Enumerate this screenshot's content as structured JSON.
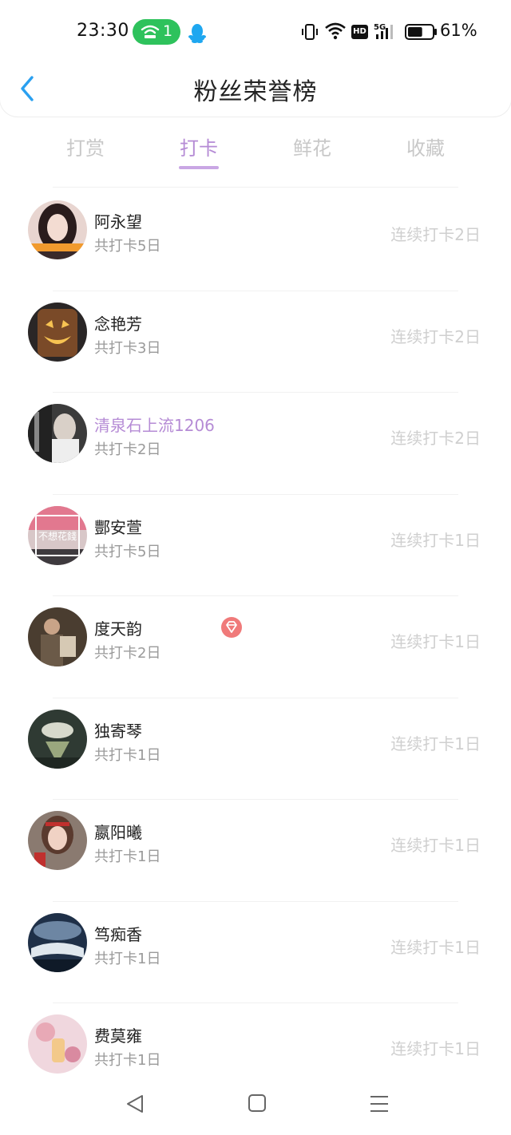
{
  "status_bar": {
    "time": "23:30",
    "hotspot_count": "1",
    "network": "5G",
    "hd_label": "HD",
    "battery_percent": "61%",
    "battery_level": 0.61
  },
  "header": {
    "title": "粉丝荣誉榜"
  },
  "tabs": [
    {
      "label": "打赏"
    },
    {
      "label": "打卡"
    },
    {
      "label": "鲜花"
    },
    {
      "label": "收藏"
    }
  ],
  "active_tab": "打卡",
  "fans": [
    {
      "name": "阿永望",
      "total": "共打卡5日",
      "streak": "连续打卡2日",
      "vip": false
    },
    {
      "name": "念艳芳",
      "total": "共打卡3日",
      "streak": "连续打卡2日",
      "vip": false
    },
    {
      "name": "清泉石上流1206",
      "total": "共打卡2日",
      "streak": "连续打卡2日",
      "vip": true
    },
    {
      "name": "酆安萱",
      "total": "共打卡5日",
      "streak": "连续打卡1日",
      "vip": false,
      "avatar_text": "不想花錢"
    },
    {
      "name": "度天韵",
      "total": "共打卡2日",
      "streak": "连续打卡1日",
      "vip": false
    },
    {
      "name": "独寄琴",
      "total": "共打卡1日",
      "streak": "连续打卡1日",
      "vip": false
    },
    {
      "name": "嬴阳曦",
      "total": "共打卡1日",
      "streak": "连续打卡1日",
      "vip": false
    },
    {
      "name": "笃痴香",
      "total": "共打卡1日",
      "streak": "连续打卡1日",
      "vip": false
    },
    {
      "name": "费莫雍",
      "total": "共打卡1日",
      "streak": "连续打卡1日",
      "vip": false
    }
  ],
  "colors": {
    "accent": "#b58bd5",
    "back_arrow": "#2aa0f0",
    "hotspot_green": "#2ec25c",
    "gem_red": "#f07a7a",
    "muted_text": "#cfcfcf"
  },
  "icons": [
    "hotspot-icon",
    "qq-icon",
    "vibrate-icon",
    "wifi-icon",
    "signal-icon",
    "battery-icon",
    "back-arrow-icon",
    "vip-gem-icon",
    "nav-back-icon",
    "nav-home-icon",
    "nav-menu-icon"
  ]
}
